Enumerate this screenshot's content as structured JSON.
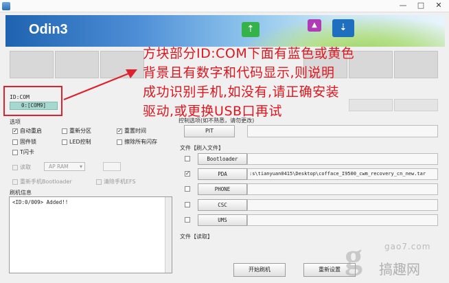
{
  "window": {
    "controls": [
      "—",
      "□",
      "✕"
    ]
  },
  "banner": {
    "title": "Odin3"
  },
  "annotation": {
    "lines": [
      "方块部分ID:COM下面有蓝色或黄色",
      "背景且有数字和代码显示,则说明",
      "成功识别手机,如没有,请正确安装",
      "驱动,或更换USB口再试"
    ],
    "color": "#e0161f"
  },
  "id_com": {
    "label": "ID:COM",
    "port": "0:[COM9]"
  },
  "options": {
    "label": "选项",
    "auto_reboot": "自动重启",
    "repartition": "重新分区",
    "reset_time": "重置时间",
    "f_lock": "固件锁",
    "led_control": "LED控制",
    "erase_all": "擦除所有闪存",
    "t_flash": "T闪卡",
    "dump": "读取",
    "dump_target": "AP RAM",
    "reset_bootloader": "重新手机Bootloader",
    "nand_erase": "清除手机EFS"
  },
  "log": {
    "label": "刷机信息",
    "text": "<ID:0/009> Added!!"
  },
  "pit": {
    "section_label": "控制选项(如不熟悉，请勿更改)",
    "button": "PIT"
  },
  "files": {
    "section_label": "文件【刷入文件】",
    "rows": [
      {
        "button": "Bootloader",
        "checked": false,
        "path": ""
      },
      {
        "button": "PDA",
        "checked": true,
        "path": ":s\\tianyuan0415\\Desktop\\cofface_I9500_cwm_recovery_cn_new.tar"
      },
      {
        "button": "PHONE",
        "checked": false,
        "path": ""
      },
      {
        "button": "CSC",
        "checked": false,
        "path": ""
      },
      {
        "button": "UMS",
        "checked": false,
        "path": ""
      }
    ]
  },
  "dump_file": {
    "label": "文件【读取】"
  },
  "buttons": {
    "start": "开始刷机",
    "reset": "重新设置"
  },
  "watermark": {
    "url": "gao7.com",
    "name": "搞趣网"
  }
}
